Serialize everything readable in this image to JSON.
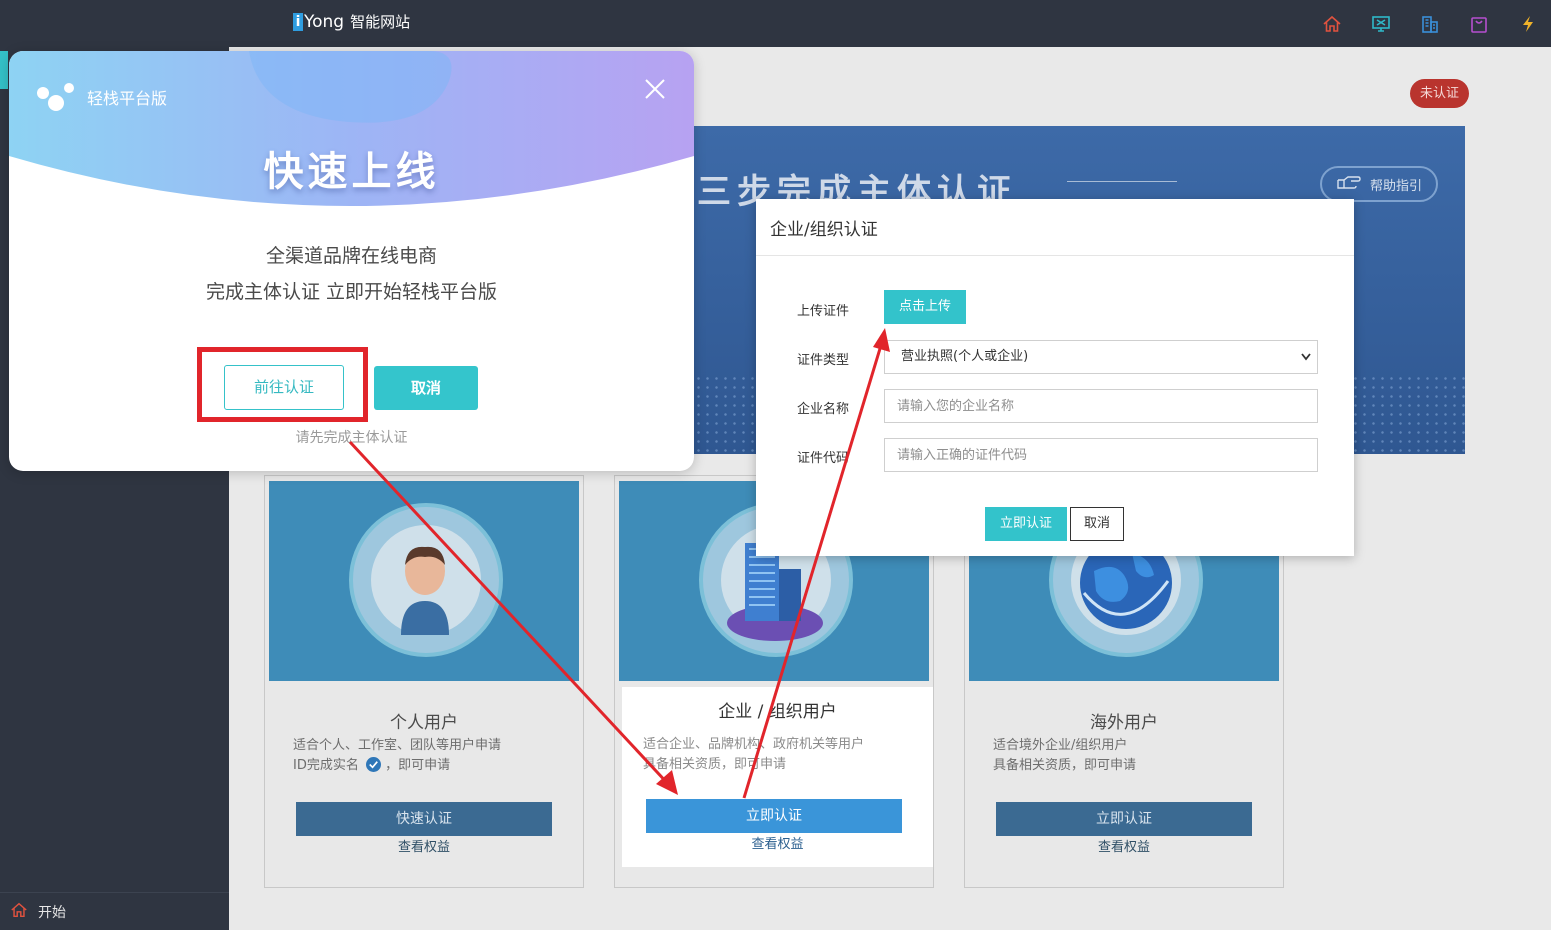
{
  "topbar": {
    "brand_mark": "i",
    "brand_name": "Yong",
    "brand_sub": "智能网站",
    "icons": [
      "home-icon",
      "monitor-icon",
      "building-icon",
      "bag-icon",
      "lightning-icon"
    ],
    "icon_colors": [
      "#e0523f",
      "#2fb9c9",
      "#3a8fd9",
      "#b64fcf",
      "#f0b32a"
    ]
  },
  "sidebar": {
    "footer_label": "开始"
  },
  "main": {
    "status_badge": "未认证",
    "banner": {
      "title": "三步完成主体认证",
      "help_label": "帮助指引"
    },
    "cards": [
      {
        "title": "个人用户",
        "desc_line1": "适合个人、工作室、团队等用户申请",
        "desc_line2": "ID完成实名",
        "desc_line2b": "，即可申请",
        "button": "快速认证",
        "link": "查看权益"
      },
      {
        "title": "企业 / 组织用户",
        "desc_line1": "适合企业、品牌机构、政府机关等用户",
        "desc_line2": "具备相关资质，即可申请",
        "button": "立即认证",
        "link": "查看权益"
      },
      {
        "title": "海外用户",
        "desc_line1": "适合境外企业/组织用户",
        "desc_line2": "具备相关资质，即可申请",
        "button": "立即认证",
        "link": "查看权益"
      }
    ]
  },
  "promo": {
    "logo_label": "轻栈平台版",
    "headline": "快速上线",
    "line1": "全渠道品牌在线电商",
    "line2": "完成主体认证 立即开始轻栈平台版",
    "go_button": "前往认证",
    "cancel_button": "取消",
    "note": "请先完成主体认证"
  },
  "dialog": {
    "title": "企业/组织认证",
    "upload_label": "上传证件",
    "upload_button": "点击上传",
    "type_label": "证件类型",
    "type_value": "营业执照(个人或企业)",
    "name_label": "企业名称",
    "name_placeholder": "请输入您的企业名称",
    "code_label": "证件代码",
    "code_placeholder": "请输入正确的证件代码",
    "submit_button": "立即认证",
    "cancel_button": "取消"
  },
  "colors": {
    "accent": "#34c5cc",
    "annotation_red": "#e1252b",
    "primary_blue": "#3a95d9"
  }
}
